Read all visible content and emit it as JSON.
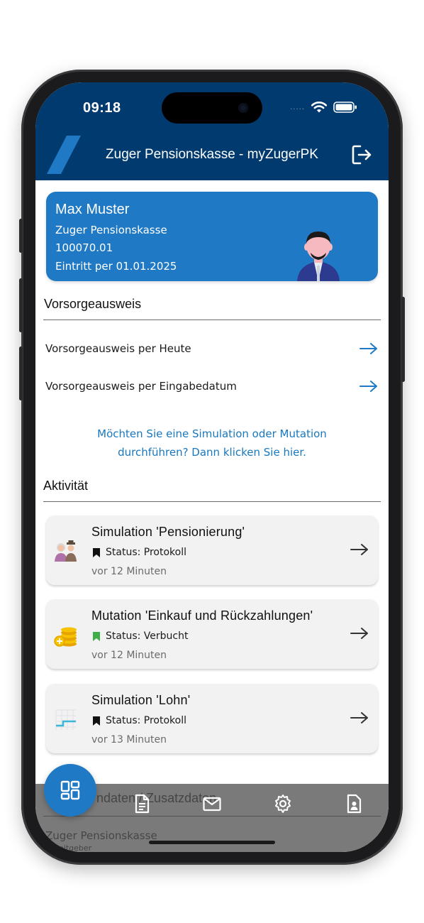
{
  "status_bar": {
    "time": "09:18",
    "signal_dots": "....."
  },
  "header": {
    "title": "Zuger Pensionskasse - myZugerPK"
  },
  "profile": {
    "name": "Max Muster",
    "organization": "Zuger Pensionskasse",
    "number": "100070.01",
    "entry": "Eintritt per 01.01.2025"
  },
  "vorsorge": {
    "heading": "Vorsorgeausweis",
    "links": [
      {
        "label": "Vorsorgeausweis per Heute"
      },
      {
        "label": "Vorsorgeausweis per Eingabedatum"
      }
    ],
    "cta_line1": "Möchten Sie eine Simulation oder Mutation",
    "cta_line2": "durchführen? Dann klicken Sie hier."
  },
  "activity": {
    "heading": "Aktivität",
    "items": [
      {
        "title": "Simulation 'Pensionierung'",
        "status": "Status: Protokoll",
        "status_color": "#111111",
        "time": "vor 12 Minuten",
        "icon": "retirement-couple-icon"
      },
      {
        "title": "Mutation 'Einkauf und Rückzahlungen'",
        "status": "Status: Verbucht",
        "status_color": "#3fae49",
        "time": "vor 12 Minuten",
        "icon": "coins-icon"
      },
      {
        "title": "Simulation 'Lohn'",
        "status": "Status: Protokoll",
        "status_color": "#111111",
        "time": "vor 13 Minuten",
        "icon": "salary-chart-icon"
      }
    ]
  },
  "background_section": {
    "heading": "ndaten / Zusatzdaten",
    "org": "Zuger Pensionskasse",
    "sub": "Arbeitgeber"
  },
  "nav": {
    "items": [
      "dashboard-icon",
      "document-icon",
      "mail-icon",
      "settings-icon",
      "profile-icon"
    ]
  },
  "colors": {
    "header_bg": "#003a6e",
    "accent": "#1f79c4",
    "link": "#1878be",
    "verbucht": "#3fae49"
  }
}
